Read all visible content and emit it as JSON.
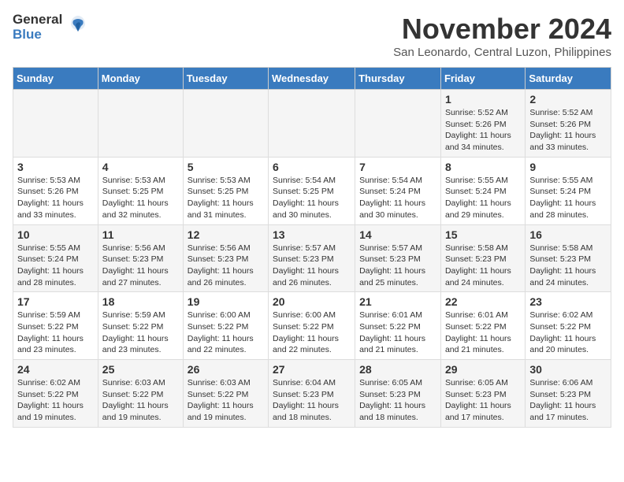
{
  "logo": {
    "general": "General",
    "blue": "Blue"
  },
  "header": {
    "month": "November 2024",
    "location": "San Leonardo, Central Luzon, Philippines"
  },
  "weekdays": [
    "Sunday",
    "Monday",
    "Tuesday",
    "Wednesday",
    "Thursday",
    "Friday",
    "Saturday"
  ],
  "weeks": [
    [
      {
        "day": "",
        "info": ""
      },
      {
        "day": "",
        "info": ""
      },
      {
        "day": "",
        "info": ""
      },
      {
        "day": "",
        "info": ""
      },
      {
        "day": "",
        "info": ""
      },
      {
        "day": "1",
        "info": "Sunrise: 5:52 AM\nSunset: 5:26 PM\nDaylight: 11 hours and 34 minutes."
      },
      {
        "day": "2",
        "info": "Sunrise: 5:52 AM\nSunset: 5:26 PM\nDaylight: 11 hours and 33 minutes."
      }
    ],
    [
      {
        "day": "3",
        "info": "Sunrise: 5:53 AM\nSunset: 5:26 PM\nDaylight: 11 hours and 33 minutes."
      },
      {
        "day": "4",
        "info": "Sunrise: 5:53 AM\nSunset: 5:25 PM\nDaylight: 11 hours and 32 minutes."
      },
      {
        "day": "5",
        "info": "Sunrise: 5:53 AM\nSunset: 5:25 PM\nDaylight: 11 hours and 31 minutes."
      },
      {
        "day": "6",
        "info": "Sunrise: 5:54 AM\nSunset: 5:25 PM\nDaylight: 11 hours and 30 minutes."
      },
      {
        "day": "7",
        "info": "Sunrise: 5:54 AM\nSunset: 5:24 PM\nDaylight: 11 hours and 30 minutes."
      },
      {
        "day": "8",
        "info": "Sunrise: 5:55 AM\nSunset: 5:24 PM\nDaylight: 11 hours and 29 minutes."
      },
      {
        "day": "9",
        "info": "Sunrise: 5:55 AM\nSunset: 5:24 PM\nDaylight: 11 hours and 28 minutes."
      }
    ],
    [
      {
        "day": "10",
        "info": "Sunrise: 5:55 AM\nSunset: 5:24 PM\nDaylight: 11 hours and 28 minutes."
      },
      {
        "day": "11",
        "info": "Sunrise: 5:56 AM\nSunset: 5:23 PM\nDaylight: 11 hours and 27 minutes."
      },
      {
        "day": "12",
        "info": "Sunrise: 5:56 AM\nSunset: 5:23 PM\nDaylight: 11 hours and 26 minutes."
      },
      {
        "day": "13",
        "info": "Sunrise: 5:57 AM\nSunset: 5:23 PM\nDaylight: 11 hours and 26 minutes."
      },
      {
        "day": "14",
        "info": "Sunrise: 5:57 AM\nSunset: 5:23 PM\nDaylight: 11 hours and 25 minutes."
      },
      {
        "day": "15",
        "info": "Sunrise: 5:58 AM\nSunset: 5:23 PM\nDaylight: 11 hours and 24 minutes."
      },
      {
        "day": "16",
        "info": "Sunrise: 5:58 AM\nSunset: 5:23 PM\nDaylight: 11 hours and 24 minutes."
      }
    ],
    [
      {
        "day": "17",
        "info": "Sunrise: 5:59 AM\nSunset: 5:22 PM\nDaylight: 11 hours and 23 minutes."
      },
      {
        "day": "18",
        "info": "Sunrise: 5:59 AM\nSunset: 5:22 PM\nDaylight: 11 hours and 23 minutes."
      },
      {
        "day": "19",
        "info": "Sunrise: 6:00 AM\nSunset: 5:22 PM\nDaylight: 11 hours and 22 minutes."
      },
      {
        "day": "20",
        "info": "Sunrise: 6:00 AM\nSunset: 5:22 PM\nDaylight: 11 hours and 22 minutes."
      },
      {
        "day": "21",
        "info": "Sunrise: 6:01 AM\nSunset: 5:22 PM\nDaylight: 11 hours and 21 minutes."
      },
      {
        "day": "22",
        "info": "Sunrise: 6:01 AM\nSunset: 5:22 PM\nDaylight: 11 hours and 21 minutes."
      },
      {
        "day": "23",
        "info": "Sunrise: 6:02 AM\nSunset: 5:22 PM\nDaylight: 11 hours and 20 minutes."
      }
    ],
    [
      {
        "day": "24",
        "info": "Sunrise: 6:02 AM\nSunset: 5:22 PM\nDaylight: 11 hours and 19 minutes."
      },
      {
        "day": "25",
        "info": "Sunrise: 6:03 AM\nSunset: 5:22 PM\nDaylight: 11 hours and 19 minutes."
      },
      {
        "day": "26",
        "info": "Sunrise: 6:03 AM\nSunset: 5:22 PM\nDaylight: 11 hours and 19 minutes."
      },
      {
        "day": "27",
        "info": "Sunrise: 6:04 AM\nSunset: 5:23 PM\nDaylight: 11 hours and 18 minutes."
      },
      {
        "day": "28",
        "info": "Sunrise: 6:05 AM\nSunset: 5:23 PM\nDaylight: 11 hours and 18 minutes."
      },
      {
        "day": "29",
        "info": "Sunrise: 6:05 AM\nSunset: 5:23 PM\nDaylight: 11 hours and 17 minutes."
      },
      {
        "day": "30",
        "info": "Sunrise: 6:06 AM\nSunset: 5:23 PM\nDaylight: 11 hours and 17 minutes."
      }
    ]
  ]
}
